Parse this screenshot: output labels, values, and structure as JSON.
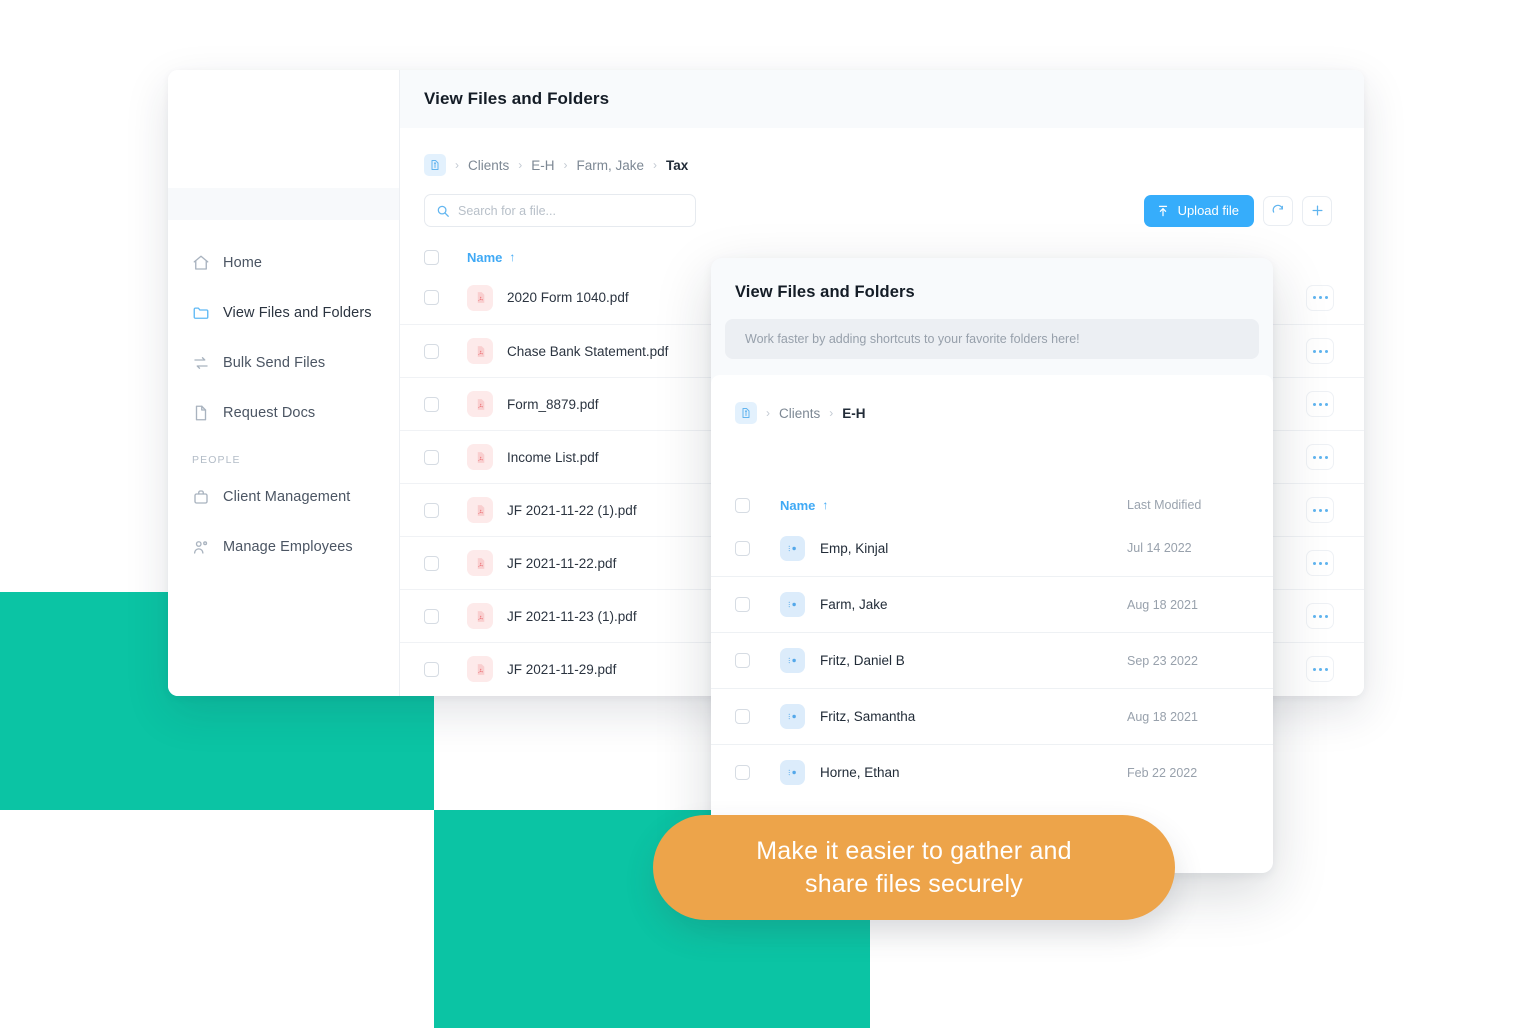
{
  "app": {
    "header_title": "View Files and Folders"
  },
  "sidebar": {
    "section_label": "PEOPLE",
    "items": [
      {
        "label": "Home",
        "icon": "home-icon"
      },
      {
        "label": "View Files and Folders",
        "icon": "folder-icon"
      },
      {
        "label": "Bulk Send Files",
        "icon": "bulk-send-icon"
      },
      {
        "label": "Request Docs",
        "icon": "document-icon"
      }
    ],
    "people_items": [
      {
        "label": "Client Management",
        "icon": "briefcase-icon"
      },
      {
        "label": "Manage Employees",
        "icon": "people-icon"
      }
    ]
  },
  "breadcrumb": {
    "home_icon": "file-home-icon",
    "items": [
      "Clients",
      "E-H",
      "Farm, Jake",
      "Tax"
    ],
    "separator": "›"
  },
  "toolbar": {
    "search_placeholder": "Search for a file...",
    "search_value": "",
    "search_icon": "search-icon",
    "upload_label": "Upload file",
    "upload_icon": "upload-icon",
    "refresh_icon": "refresh-icon",
    "add_icon": "plus-icon"
  },
  "file_table": {
    "columns": [
      "Name",
      "Last Modified"
    ],
    "sort_arrow": "↑",
    "rows": [
      {
        "name": "2020 Form 1040.pdf",
        "type": "pdf"
      },
      {
        "name": "Chase Bank Statement.pdf",
        "type": "pdf"
      },
      {
        "name": "Form_8879.pdf",
        "type": "pdf"
      },
      {
        "name": "Income List.pdf",
        "type": "pdf"
      },
      {
        "name": "JF 2021-11-22 (1).pdf",
        "type": "pdf"
      },
      {
        "name": "JF 2021-11-22.pdf",
        "type": "pdf"
      },
      {
        "name": "JF 2021-11-23 (1).pdf",
        "type": "pdf"
      },
      {
        "name": "JF 2021-11-29.pdf",
        "type": "pdf"
      }
    ]
  },
  "modal": {
    "title": "View Files and Folders",
    "hint": "Work faster by adding shortcuts to your favorite folders here!",
    "breadcrumb": {
      "home_icon": "file-home-icon",
      "items": [
        "Clients",
        "E-H"
      ],
      "separator": "›"
    },
    "columns": {
      "name": "Name",
      "last_modified": "Last Modified"
    },
    "sort_arrow": "↑",
    "rows": [
      {
        "name": "Emp, Kinjal",
        "modified": "Jul 14 2022"
      },
      {
        "name": "Farm, Jake",
        "modified": "Aug 18 2021"
      },
      {
        "name": "Fritz, Daniel B",
        "modified": "Sep 23 2022"
      },
      {
        "name": "Fritz, Samantha",
        "modified": "Aug 18 2021"
      },
      {
        "name": "Horne, Ethan",
        "modified": "Feb 22 2022"
      }
    ]
  },
  "callout": {
    "text": "Make it easier to gather and\nshare files securely"
  },
  "colors": {
    "accent_blue": "#36adfb",
    "link_blue": "#3fa9f5",
    "brand_green": "#0bc4a4",
    "callout_orange": "#eda44a",
    "pdf_red_bg": "#fdeaea",
    "text_dark": "#141c26"
  }
}
